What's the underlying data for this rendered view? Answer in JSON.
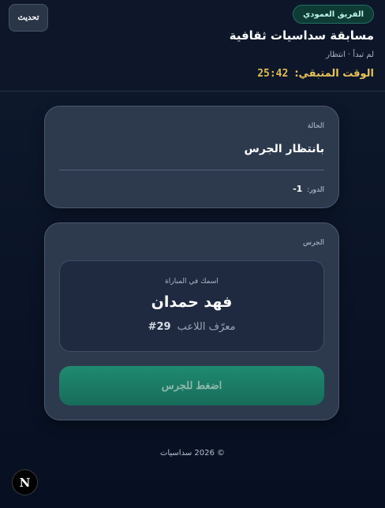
{
  "header": {
    "team_badge": "الفريق العمودي",
    "title": "مسابقة سداسيات ثقافية",
    "subtitle": "لم تبدأ · انتظار",
    "timer_label": "الوقت المتبقي:",
    "timer_value": "25:42",
    "refresh_label": "تحديث"
  },
  "status_card": {
    "label": "الحالة",
    "value": "بانتظار الجرس",
    "round_label": "الدور:",
    "round_value": "-1"
  },
  "bell_card": {
    "label": "الجرس",
    "player_caption": "اسمك في المباراة",
    "player_name": "فهد حمدان",
    "player_id_label": "معرّف اللاعب",
    "player_id_value": "#29",
    "bell_button": "اضغط للجرس"
  },
  "footer": {
    "text": "© 2026 سداسيات"
  },
  "dev_badge": {
    "letter": "N"
  },
  "colors": {
    "background": "#0a1426",
    "card": "#2d3a4e",
    "accent_green": "#1f8a70",
    "timer_gold": "#e2bb55"
  }
}
